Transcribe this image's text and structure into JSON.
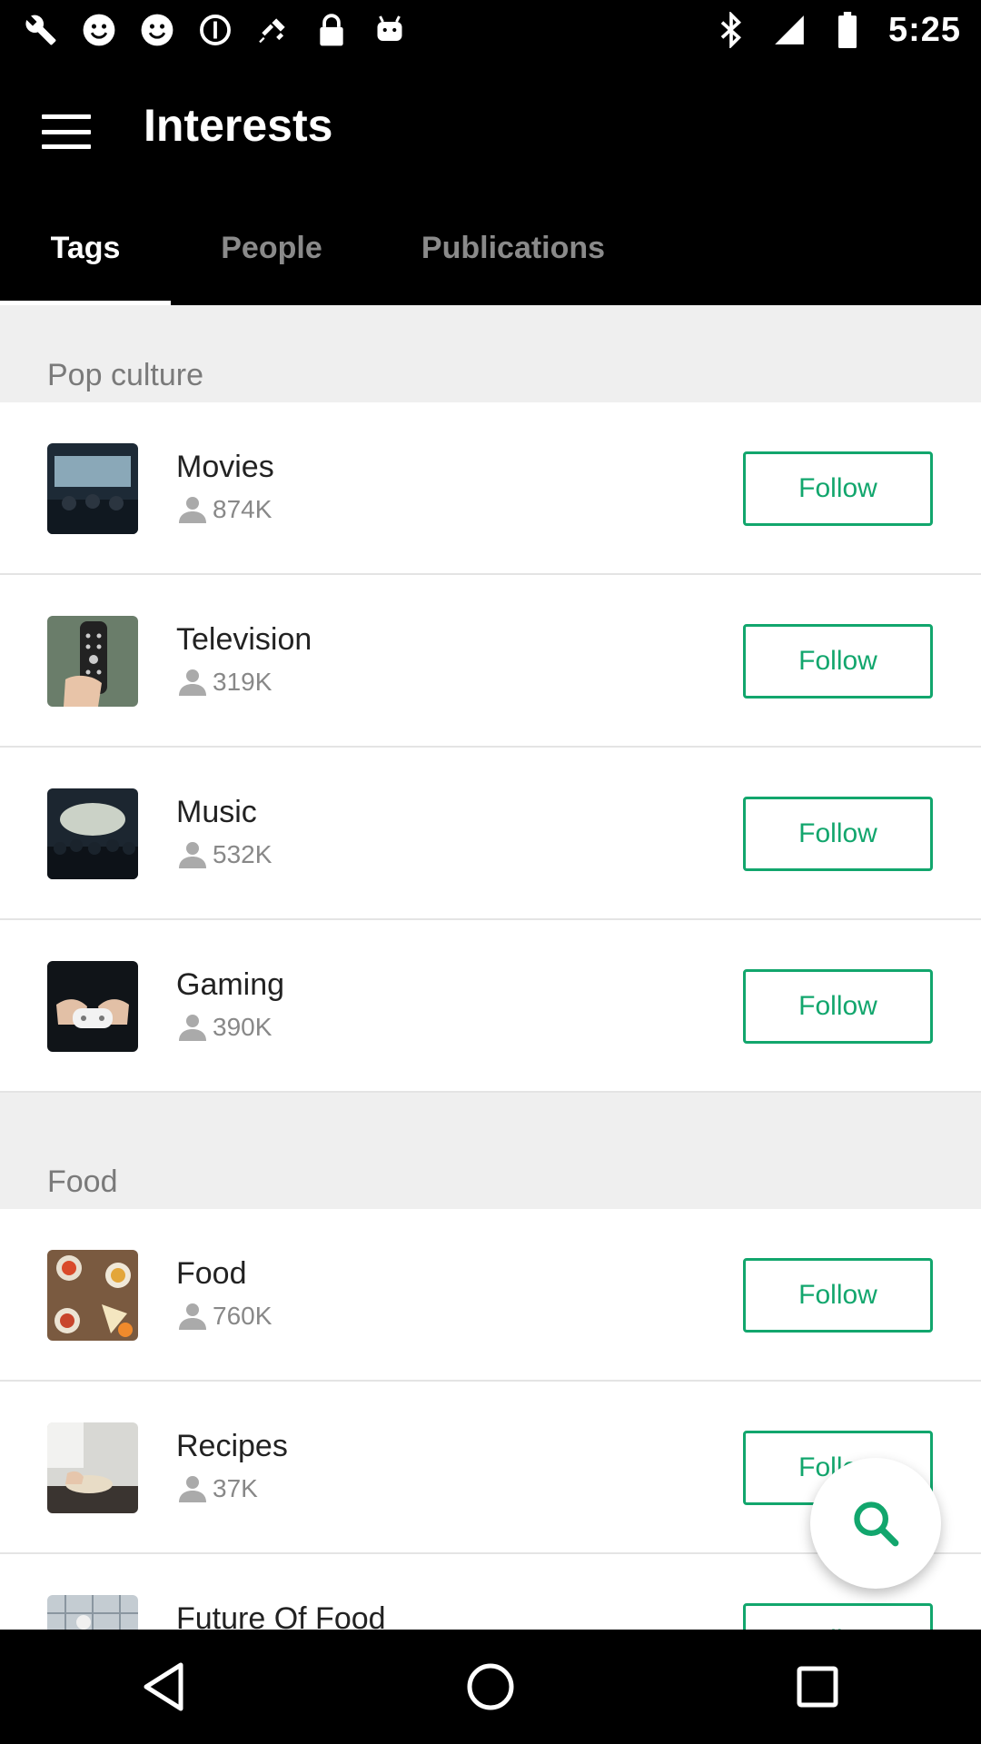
{
  "status_bar": {
    "time": "5:25",
    "icons": [
      "wrench-icon",
      "smiley-icon",
      "smiley-icon",
      "data-saver-icon",
      "no-signal-satellite-icon",
      "lock-icon",
      "android-icon",
      "bluetooth-icon",
      "signal-icon",
      "battery-icon"
    ]
  },
  "app_bar": {
    "title": "Interests"
  },
  "tabs": [
    {
      "label": "Tags",
      "active": true
    },
    {
      "label": "People",
      "active": false
    },
    {
      "label": "Publications",
      "active": false
    }
  ],
  "sections": [
    {
      "header": "Pop culture",
      "items": [
        {
          "title": "Movies",
          "count": "874K",
          "button": "Follow"
        },
        {
          "title": "Television",
          "count": "319K",
          "button": "Follow"
        },
        {
          "title": "Music",
          "count": "532K",
          "button": "Follow"
        },
        {
          "title": "Gaming",
          "count": "390K",
          "button": "Follow"
        }
      ]
    },
    {
      "header": "Food",
      "items": [
        {
          "title": "Food",
          "count": "760K",
          "button": "Follow"
        },
        {
          "title": "Recipes",
          "count": "37K",
          "button": "Follow"
        },
        {
          "title": "Future Of Food",
          "count": "",
          "button": "Follow"
        }
      ]
    }
  ],
  "colors": {
    "accent": "#12a66d",
    "bar": "#000000",
    "section_bg": "#efefef"
  }
}
